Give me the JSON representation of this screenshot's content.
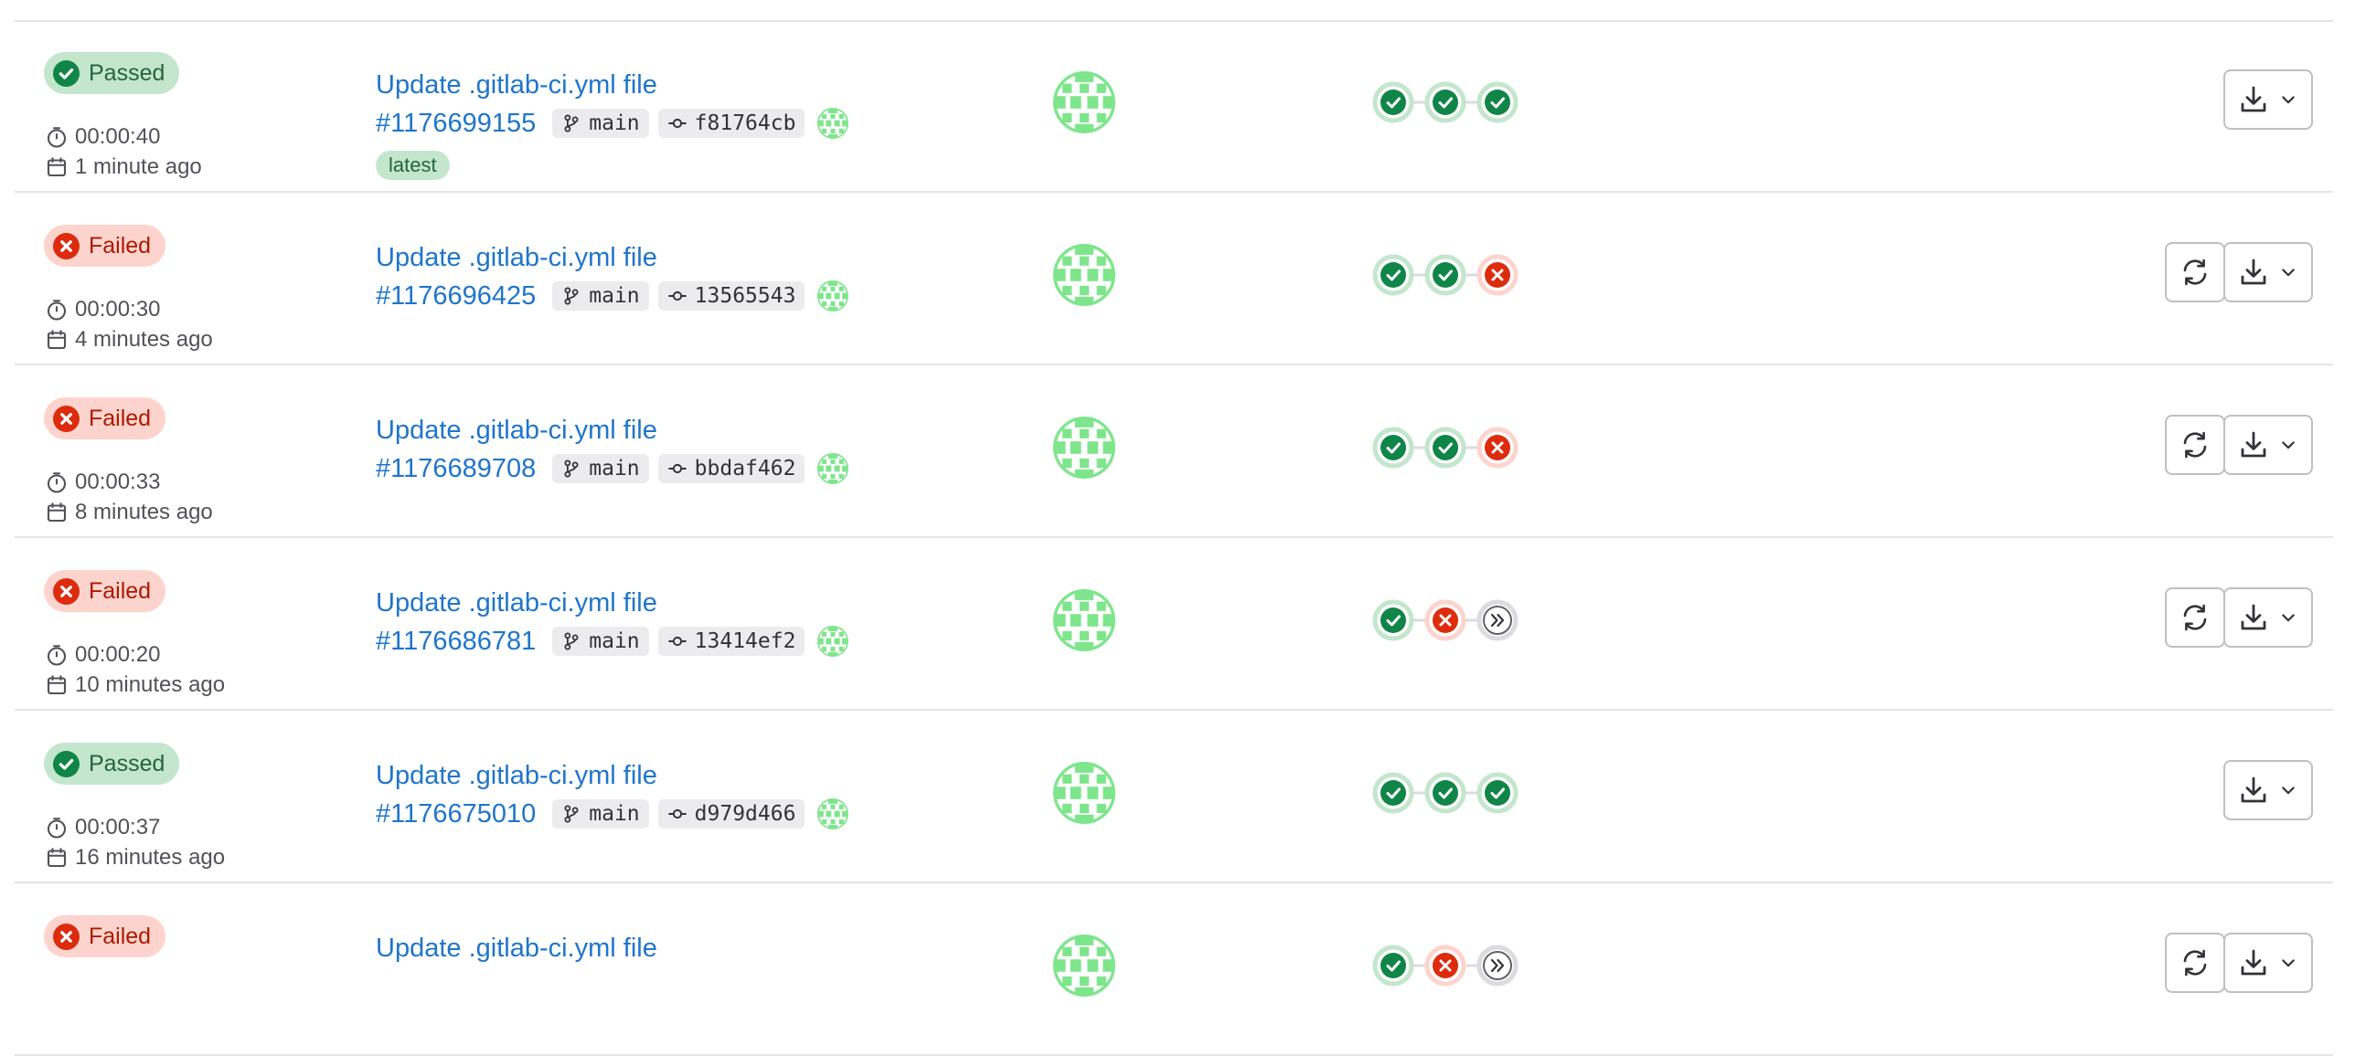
{
  "pipelines": [
    {
      "status": "success",
      "status_label": "Passed",
      "duration": "00:00:40",
      "finished": "1 minute ago",
      "commit_title": "Update .gitlab-ci.yml file",
      "pipeline_id": "#1176699155",
      "branch": "main",
      "sha": "f81764cb",
      "latest_label": "latest",
      "stages": [
        "success",
        "success",
        "success"
      ],
      "retry": false
    },
    {
      "status": "failed",
      "status_label": "Failed",
      "duration": "00:00:30",
      "finished": "4 minutes ago",
      "commit_title": "Update .gitlab-ci.yml file",
      "pipeline_id": "#1176696425",
      "branch": "main",
      "sha": "13565543",
      "latest_label": "",
      "stages": [
        "success",
        "success",
        "failed"
      ],
      "retry": true
    },
    {
      "status": "failed",
      "status_label": "Failed",
      "duration": "00:00:33",
      "finished": "8 minutes ago",
      "commit_title": "Update .gitlab-ci.yml file",
      "pipeline_id": "#1176689708",
      "branch": "main",
      "sha": "bbdaf462",
      "latest_label": "",
      "stages": [
        "success",
        "success",
        "failed"
      ],
      "retry": true
    },
    {
      "status": "failed",
      "status_label": "Failed",
      "duration": "00:00:20",
      "finished": "10 minutes ago",
      "commit_title": "Update .gitlab-ci.yml file",
      "pipeline_id": "#1176686781",
      "branch": "main",
      "sha": "13414ef2",
      "latest_label": "",
      "stages": [
        "success",
        "failed",
        "skipped"
      ],
      "retry": true
    },
    {
      "status": "success",
      "status_label": "Passed",
      "duration": "00:00:37",
      "finished": "16 minutes ago",
      "commit_title": "Update .gitlab-ci.yml file",
      "pipeline_id": "#1176675010",
      "branch": "main",
      "sha": "d979d466",
      "latest_label": "",
      "stages": [
        "success",
        "success",
        "success"
      ],
      "retry": false
    },
    {
      "status": "failed",
      "status_label": "Failed",
      "duration": "",
      "finished": "",
      "commit_title": "Update .gitlab-ci.yml file",
      "pipeline_id": "",
      "branch": "",
      "sha": "",
      "latest_label": "",
      "stages": [
        "success",
        "failed",
        "skipped"
      ],
      "retry": true
    }
  ],
  "icons": {
    "status_success": "check-circle-icon",
    "status_failed": "x-circle-icon",
    "duration": "timer-icon",
    "date": "calendar-icon",
    "branch": "branch-icon",
    "commit": "commit-icon",
    "retry": "retry-icon",
    "download": "download-icon",
    "dropdown": "chevron-down-icon",
    "stage_skipped": "chevron-double-right-icon"
  },
  "colors": {
    "link": "#1f75cb",
    "success": "#108548",
    "success_bg": "#c3e6cd",
    "failed": "#dd2b0e",
    "failed_bg": "#fdd4cd",
    "avatar": "#7ee58c"
  }
}
